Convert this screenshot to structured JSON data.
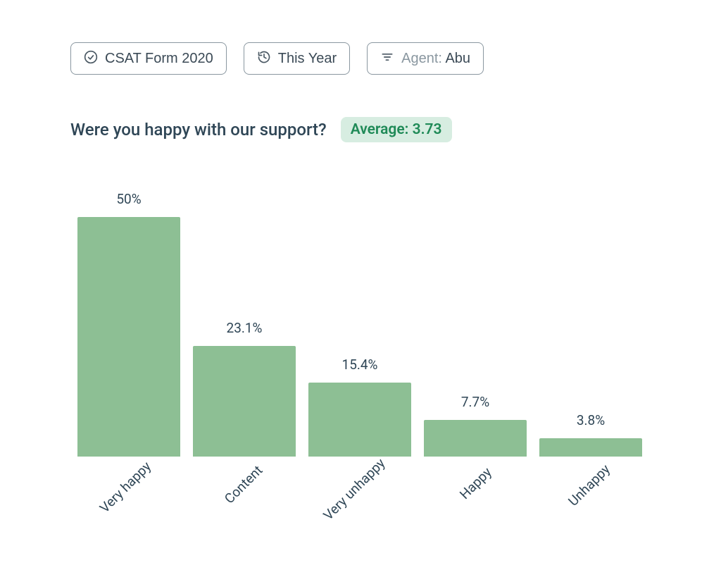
{
  "filters": {
    "form": {
      "label": "CSAT Form 2020"
    },
    "period": {
      "label": "This Year"
    },
    "agent": {
      "prefix": "Agent:",
      "value": "Abu"
    }
  },
  "question": "Were you happy with our support?",
  "average": {
    "prefix": "Average:",
    "value": "3.73"
  },
  "chart_data": {
    "type": "bar",
    "title": "Were you happy with our support?",
    "categories": [
      "Very happy",
      "Content",
      "Very unhappy",
      "Happy",
      "Unhappy"
    ],
    "values": [
      50,
      23.1,
      15.4,
      7.7,
      3.8
    ],
    "value_labels": [
      "50%",
      "23.1%",
      "15.4%",
      "7.7%",
      "3.8%"
    ],
    "ylim": [
      0,
      50
    ],
    "ylabel": "",
    "xlabel": ""
  },
  "colors": {
    "bar": "#8dbf94",
    "badge_bg": "#d7ede1",
    "badge_fg": "#1f8a57",
    "text": "#2f4656",
    "border": "#8a97a0"
  }
}
